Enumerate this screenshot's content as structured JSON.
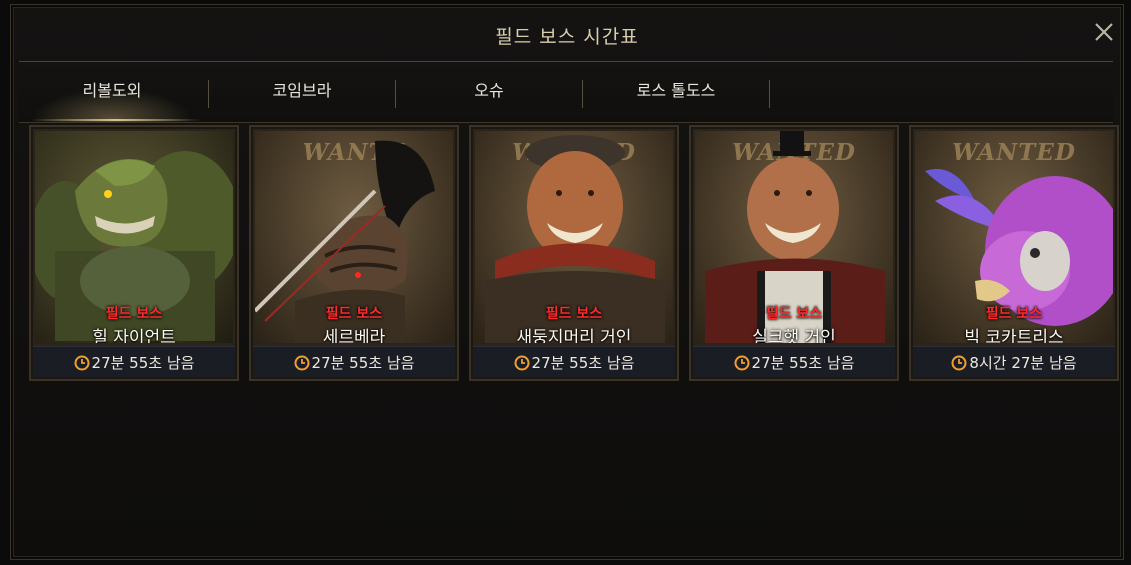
{
  "window": {
    "title": "필드 보스 시간표"
  },
  "tabs": [
    {
      "label": "리볼도외",
      "active": true
    },
    {
      "label": "코임브라",
      "active": false
    },
    {
      "label": "오슈",
      "active": false
    },
    {
      "label": "로스 톨도스",
      "active": false
    }
  ],
  "cards": [
    {
      "banner": "",
      "tag": "필드 보스",
      "name": "힐 자이언트",
      "time": "27분 55초 남음"
    },
    {
      "banner": "WANTE",
      "tag": "필드 보스",
      "name": "세르베라",
      "time": "27분 55초 남음"
    },
    {
      "banner": "WANTED",
      "tag": "필드 보스",
      "name": "새둥지머리 거인",
      "time": "27분 55초 남음"
    },
    {
      "banner": "WANTED",
      "tag": "필드 보스",
      "name": "실크햇 거인",
      "time": "27분 55초 남음"
    },
    {
      "banner": "WANTED",
      "tag": "필드 보스",
      "name": "빅 코카트리스",
      "time": "8시간 27분 남음"
    }
  ],
  "colors": {
    "accent_gold": "#d9cfae",
    "boss_tag_red": "#ff2b2b",
    "clock_orange": "#f0a030"
  },
  "icons": {
    "close": "close-icon",
    "clock": "clock-icon"
  }
}
